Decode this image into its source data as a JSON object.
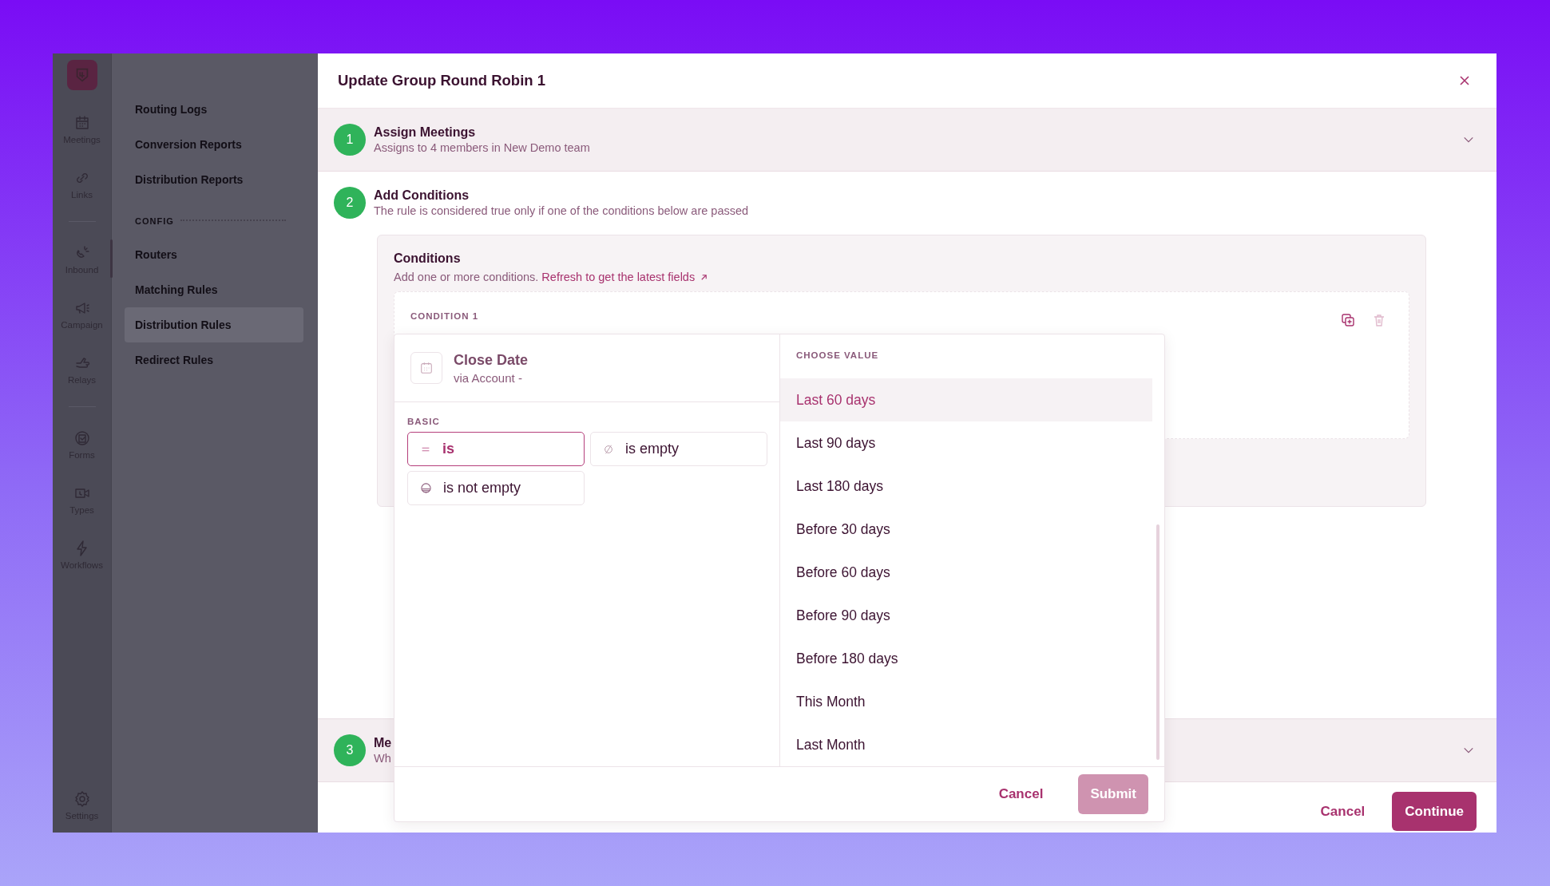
{
  "sidebar": {
    "rail_groups": [
      [
        {
          "label": "Meetings",
          "selected": false
        },
        {
          "label": "Links",
          "selected": false
        }
      ],
      [
        {
          "label": "Inbound",
          "selected": true
        },
        {
          "label": "Campaign",
          "selected": false
        },
        {
          "label": "Relays",
          "selected": false
        }
      ],
      [
        {
          "label": "Forms",
          "selected": false
        },
        {
          "label": "Types",
          "selected": false
        },
        {
          "label": "Workflows",
          "selected": false
        }
      ]
    ],
    "rail_bottom": {
      "label": "Settings",
      "selected": false
    },
    "nav": [
      {
        "kind": "item",
        "label": "Routing Logs",
        "selected": false
      },
      {
        "kind": "item",
        "label": "Conversion Reports",
        "selected": false
      },
      {
        "kind": "item",
        "label": "Distribution Reports",
        "selected": false
      },
      {
        "kind": "heading",
        "label": "CONFIG"
      },
      {
        "kind": "item",
        "label": "Routers",
        "selected": false
      },
      {
        "kind": "item",
        "label": "Matching Rules",
        "selected": false
      },
      {
        "kind": "item",
        "label": "Distribution Rules",
        "selected": true
      },
      {
        "kind": "item",
        "label": "Redirect Rules",
        "selected": false
      }
    ]
  },
  "modal": {
    "title": "Update Group Round Robin 1",
    "steps": [
      {
        "number": "1",
        "title": "Assign Meetings",
        "subtitle": "Assigns to 4 members in New Demo team",
        "expanded": false
      },
      {
        "number": "2",
        "title": "Add Conditions",
        "subtitle": "The rule is considered true only if one of the conditions below are passed",
        "expanded": true
      },
      {
        "number": "3",
        "title": "Me",
        "subtitle": "Wh",
        "expanded": false
      }
    ],
    "conditions": {
      "title": "Conditions",
      "description": "Add one or more conditions.",
      "link": "Refresh to get the latest fields",
      "condition_label": "CONDITION 1"
    },
    "popover": {
      "field": {
        "name": "Close Date",
        "source": "via Account -"
      },
      "operators_label": "BASIC",
      "operators": [
        {
          "label": "is",
          "selected": true
        },
        {
          "label": "is empty",
          "selected": false
        },
        {
          "label": "is not empty",
          "selected": false
        }
      ],
      "values_label": "CHOOSE VALUE",
      "values": [
        {
          "label": "Last 60 days",
          "selected": true
        },
        {
          "label": "Last 90 days",
          "selected": false
        },
        {
          "label": "Last 180 days",
          "selected": false
        },
        {
          "label": "Before 30 days",
          "selected": false
        },
        {
          "label": "Before 60 days",
          "selected": false
        },
        {
          "label": "Before 90 days",
          "selected": false
        },
        {
          "label": "Before 180 days",
          "selected": false
        },
        {
          "label": "This Month",
          "selected": false
        },
        {
          "label": "Last Month",
          "selected": false
        }
      ],
      "cancel": "Cancel",
      "submit": {
        "label": "Submit",
        "disabled": true
      }
    },
    "cancel": "Cancel",
    "continue": "Continue"
  }
}
